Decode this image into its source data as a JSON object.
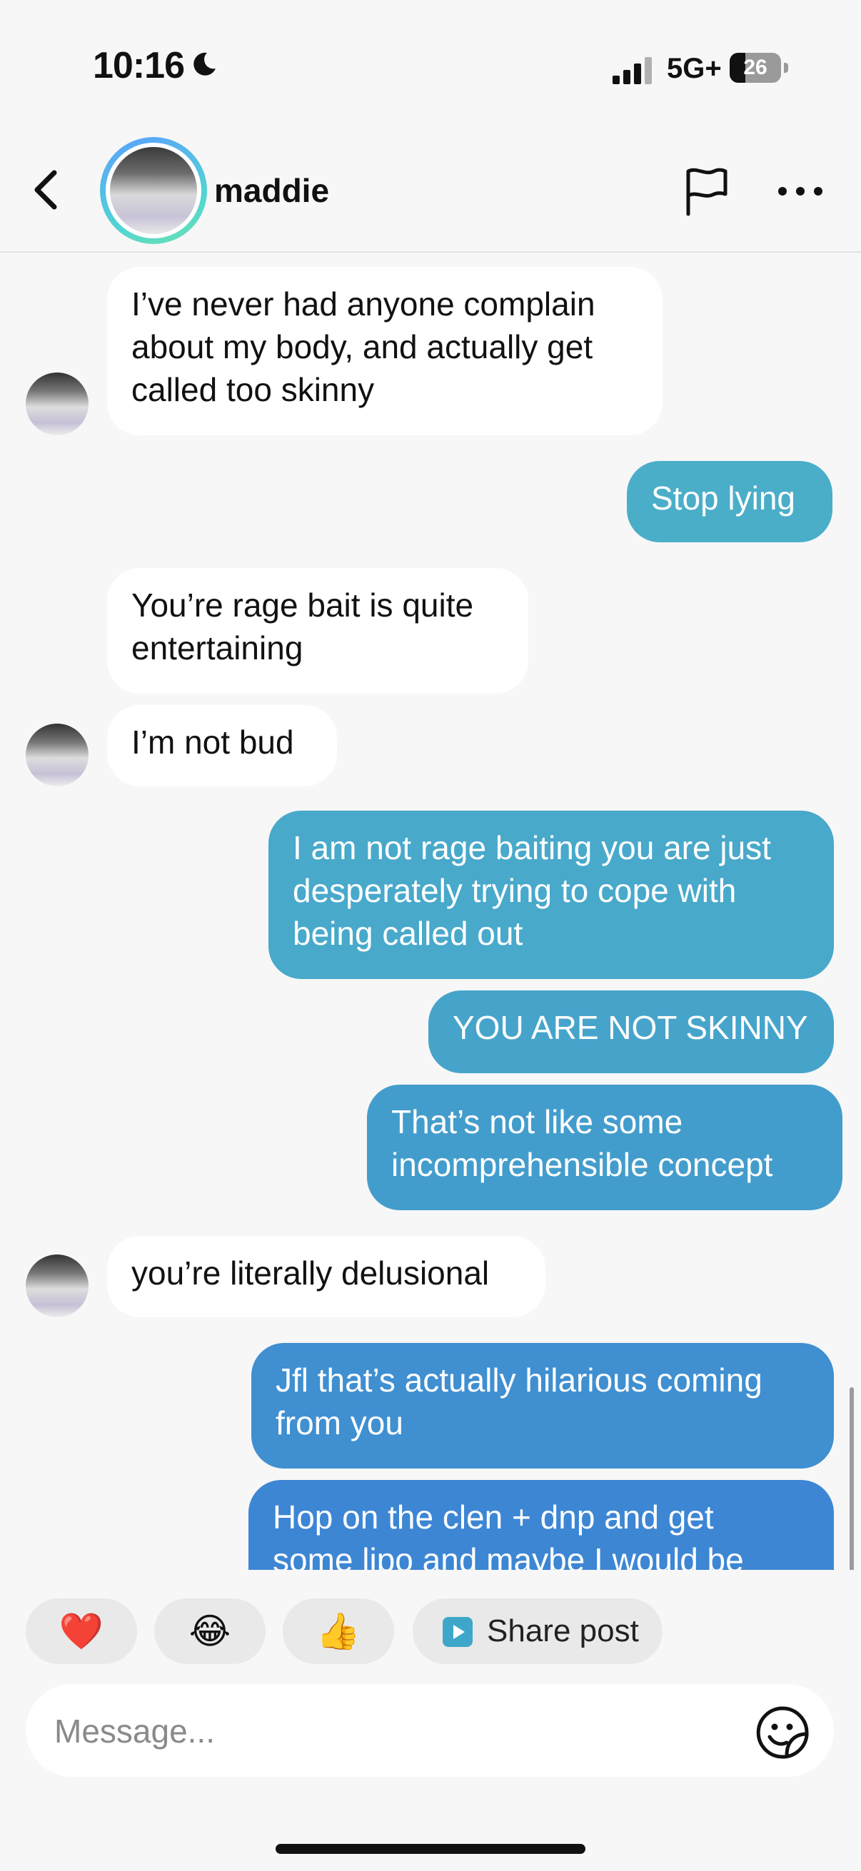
{
  "status_bar": {
    "time": "10:16",
    "network": "5G+",
    "battery": "26"
  },
  "header": {
    "username": "maddie"
  },
  "messages": [
    {
      "side": "in",
      "text": "I’ve never had anyone complain\nabout my body, and actually get\ncalled too skinny"
    },
    {
      "side": "out",
      "text": "Stop lying",
      "color": "#4aaec9"
    },
    {
      "side": "in",
      "text": "You’re rage bait is quite\nentertaining"
    },
    {
      "side": "in",
      "text": "I’m not bud"
    },
    {
      "side": "out",
      "text": "I am not rage baiting you are just\ndesperately trying to cope with\nbeing called out",
      "color": "#48a9cb"
    },
    {
      "side": "out",
      "text": "YOU ARE NOT SKINNY",
      "color": "#46a4cb"
    },
    {
      "side": "out",
      "text": "That’s not like some\nincomprehensible concept",
      "color": "#439dcc"
    },
    {
      "side": "in",
      "text": "you’re literally delusional"
    },
    {
      "side": "out",
      "text": "Jfl that’s actually hilarious coming\nfrom you",
      "color": "#3f8fd1"
    },
    {
      "side": "out",
      "text": "Hop on the clen + dnp and get\nsome lipo and maybe I would be",
      "color": "#3d86d4"
    }
  ],
  "reactions": [
    "❤️",
    "😂",
    "👍"
  ],
  "share_post": {
    "label": "Share post"
  },
  "composer": {
    "placeholder": "Message..."
  }
}
